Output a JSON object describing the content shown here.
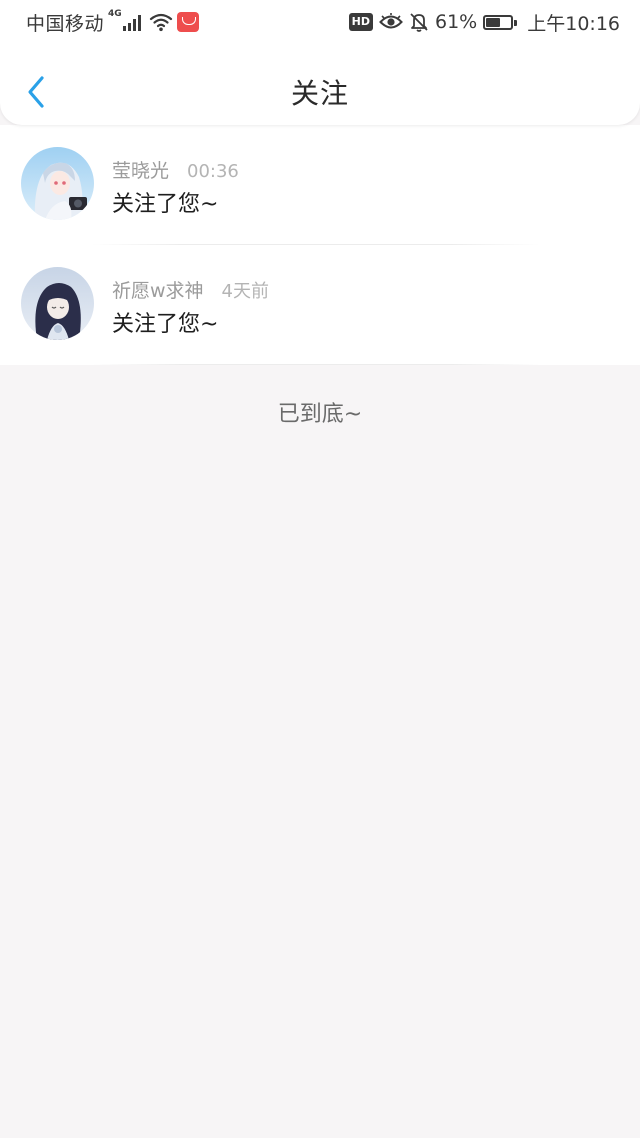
{
  "status_bar": {
    "carrier": "中国移动",
    "network": "4G",
    "hd": "HD",
    "battery_percent": "61%",
    "battery_level": 0.61,
    "time": "上午10:16"
  },
  "header": {
    "title": "关注",
    "back_icon": "chevron-left-icon",
    "accent_color": "#2aa1e8"
  },
  "notifications": [
    {
      "username": "莹晓光",
      "time": "00:36",
      "message": "关注了您~"
    },
    {
      "username": "祈愿w求神",
      "time": "4天前",
      "message": "关注了您~"
    }
  ],
  "end_of_list": "已到底~"
}
